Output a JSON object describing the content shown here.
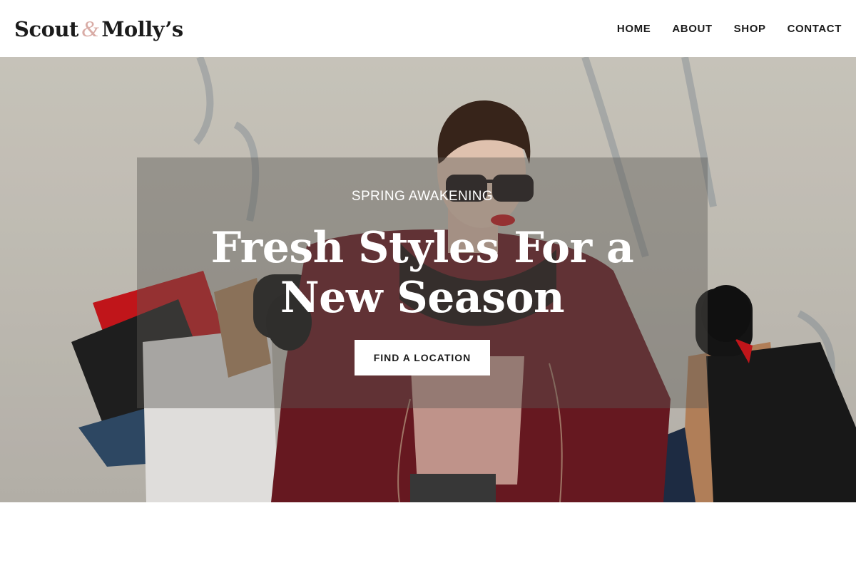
{
  "header": {
    "logo": {
      "part1": "Scout",
      "amp": "&",
      "part2": "Molly’s"
    },
    "nav": [
      {
        "label": "HOME"
      },
      {
        "label": "ABOUT"
      },
      {
        "label": "SHOP"
      },
      {
        "label": "CONTACT"
      }
    ]
  },
  "hero": {
    "eyebrow": "SPRING AWAKENING",
    "title": "Fresh Styles For a New Season",
    "cta_label": "FIND A LOCATION",
    "image": "woman-with-shopping-bags-photo"
  },
  "colors": {
    "logo_accent": "#d9aca6",
    "text_dark": "#1b1b1b",
    "panel_overlay": "rgba(90,88,84,0.42)",
    "coat": "#6e1820"
  }
}
